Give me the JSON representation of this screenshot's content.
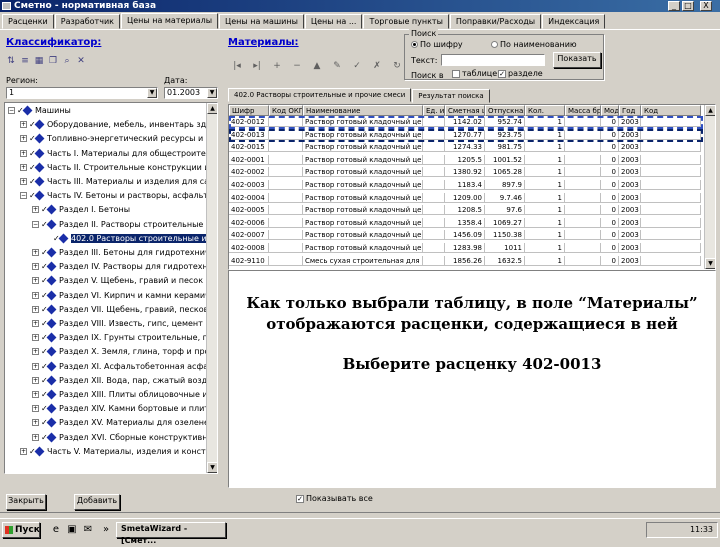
{
  "window": {
    "title": "Сметно - нормативная база",
    "controls": [
      "_",
      "□",
      "X"
    ]
  },
  "tabs": [
    {
      "label": "Расценки",
      "active": false
    },
    {
      "label": "Разработчик",
      "active": false
    },
    {
      "label": "Цены на материалы",
      "active": true
    },
    {
      "label": "Цены на машины",
      "active": false
    },
    {
      "label": "Цены на ...",
      "active": false
    },
    {
      "label": "Торговые пункты",
      "active": false
    },
    {
      "label": "Поправки/Расходы",
      "active": false
    },
    {
      "label": "Индексация",
      "active": false
    }
  ],
  "left": {
    "heading": "Классификатор:",
    "toolbar_icons": [
      "sort-icon",
      "filter-icon",
      "table-icon",
      "copy-icon",
      "find-icon",
      "close-icon"
    ],
    "region_label": "Регион:",
    "date_label": "Дата:",
    "region_value": "1",
    "date_value": "01.2003",
    "tree": [
      {
        "indent": 0,
        "box": "−",
        "label": "Машины",
        "selected": false
      },
      {
        "indent": 1,
        "box": "+",
        "label": "Оборудование, мебель, инвентарь здания и сооружения",
        "selected": false
      },
      {
        "indent": 1,
        "box": "+",
        "label": "Топливно-энергетический ресурсы и строительство",
        "selected": false
      },
      {
        "indent": 1,
        "box": "+",
        "label": "Часть I. Материалы для общестроительных работ",
        "selected": false
      },
      {
        "indent": 1,
        "box": "+",
        "label": "Часть II. Строительные конструкции и изделия",
        "selected": false
      },
      {
        "indent": 1,
        "box": "+",
        "label": "Часть III. Материалы и изделия для сантехнических",
        "selected": false
      },
      {
        "indent": 1,
        "box": "−",
        "label": "Часть IV. Бетоны и растворы, асфальтобетонные и прочие",
        "selected": false
      },
      {
        "indent": 2,
        "box": "+",
        "label": "Раздел I. Бетоны",
        "selected": false
      },
      {
        "indent": 2,
        "box": "−",
        "label": "Раздел II. Растворы строительные и прочие",
        "selected": false
      },
      {
        "indent": 3,
        "box": "",
        "label": "402.0 Растворы строительные и прочие",
        "selected": true
      },
      {
        "indent": 2,
        "box": "+",
        "label": "Раздел III. Бетоны для гидротехнических",
        "selected": false
      },
      {
        "indent": 2,
        "box": "+",
        "label": "Раздел IV. Растворы для гидротехнических",
        "selected": false
      },
      {
        "indent": 2,
        "box": "+",
        "label": "Раздел V. Щебень, гравий и песок для строительных",
        "selected": false
      },
      {
        "indent": 2,
        "box": "+",
        "label": "Раздел VI. Кирпич и камни керамические",
        "selected": false
      },
      {
        "indent": 2,
        "box": "+",
        "label": "Раздел VII. Щебень, гравий, песковые массы",
        "selected": false
      },
      {
        "indent": 2,
        "box": "+",
        "label": "Раздел VIII. Известь, гипс, цемент",
        "selected": false
      },
      {
        "indent": 2,
        "box": "+",
        "label": "Раздел IX. Грунты строительные, песок, грунт",
        "selected": false
      },
      {
        "indent": 2,
        "box": "+",
        "label": "Раздел X. Земля, глина, торф и прочие грунты",
        "selected": false
      },
      {
        "indent": 2,
        "box": "+",
        "label": "Раздел XI. Асфальтобетонная асфальтобетонная",
        "selected": false
      },
      {
        "indent": 2,
        "box": "+",
        "label": "Раздел XII. Вода, пар, сжатый воздух, кислород",
        "selected": false
      },
      {
        "indent": 2,
        "box": "+",
        "label": "Раздел XIII. Плиты облицовочные и материалы",
        "selected": false
      },
      {
        "indent": 2,
        "box": "+",
        "label": "Раздел XIV. Камни бортовые и плиточные",
        "selected": false
      },
      {
        "indent": 2,
        "box": "+",
        "label": "Раздел XV. Материалы для озеленения",
        "selected": false
      },
      {
        "indent": 2,
        "box": "+",
        "label": "Раздел XVI. Сборные конструктивные элементы",
        "selected": false
      },
      {
        "indent": 1,
        "box": "+",
        "label": "Часть V. Материалы, изделия и конструкции для",
        "selected": false
      }
    ],
    "buttons": {
      "close": "Закрыть",
      "add": "Добавить"
    }
  },
  "right": {
    "heading": "Материалы:",
    "search_group_title": "Поиск",
    "radio_by_code": "По шифру",
    "radio_by_name": "По наименованию",
    "text_label": "Текст:",
    "search_button": "Показать",
    "search_text": "",
    "search_in_label": "Поиск в",
    "check_table": "таблице",
    "check_section": "разделе",
    "nav_icons": [
      "first-icon",
      "next-icon",
      "add-icon",
      "remove-icon",
      "up-icon",
      "edit-icon",
      "apply-icon",
      "cancel-icon",
      "refresh-icon"
    ],
    "subtabs": [
      {
        "label": "402.0 Растворы строительные и прочие смеси",
        "active": true
      },
      {
        "label": "Результат поиска",
        "active": false
      }
    ],
    "columns": [
      "Шифр",
      "Код ОКП",
      "Наименование",
      "Ед. изм.",
      "Сметная цена",
      "Отпускная цена",
      "Кол.",
      "Масса брутто",
      "Мод.",
      "Год",
      "Код"
    ],
    "rows": [
      [
        "402-0012",
        "",
        "Раствор готовый кладочный цемент-0",
        "",
        "1142.02",
        "952.74",
        "1",
        "",
        "0",
        "2003",
        ""
      ],
      [
        "402-0013",
        "",
        "Раствор готовый кладочный цемент-0",
        "",
        "1270.77",
        "923.75",
        "1",
        "",
        "0",
        "2003",
        ""
      ],
      [
        "402-0015",
        "",
        "Раствор готовый кладочный цемент-8",
        "",
        "1274.33",
        "981.75",
        "1",
        "",
        "0",
        "2003",
        ""
      ],
      [
        "402-0001",
        "",
        "Раствор готовый кладочный цемент-0",
        "",
        "1205.5",
        "1001.52",
        "1",
        "",
        "0",
        "2003",
        ""
      ],
      [
        "402-0002",
        "",
        "Раствор готовый кладочный цемент-8",
        "",
        "1380.92",
        "1065.28",
        "1",
        "",
        "0",
        "2003",
        ""
      ],
      [
        "402-0003",
        "",
        "Раствор готовый кладочный цемент-0",
        "",
        "1183.4",
        "897.9",
        "1",
        "",
        "0",
        "2003",
        ""
      ],
      [
        "402-0004",
        "",
        "Раствор готовый кладочный цемент-0",
        "",
        "1209.00",
        "9.7.46",
        "1",
        "",
        "0",
        "2003",
        ""
      ],
      [
        "402-0005",
        "",
        "Раствор готовый кладочный цемент-0",
        "",
        "1208.5",
        "97.6",
        "1",
        "",
        "0",
        "2003",
        ""
      ],
      [
        "402-0006",
        "",
        "Раствор готовый кладочный цемент-8",
        "",
        "1358.4",
        "1069.27",
        "1",
        "",
        "0",
        "2003",
        ""
      ],
      [
        "402-0007",
        "",
        "Раствор готовый кладочный цемент-8",
        "",
        "1456.09",
        "1150.38",
        "1",
        "",
        "0",
        "2003",
        ""
      ],
      [
        "402-0008",
        "",
        "Раствор готовый кладочный цемент-8",
        "",
        "1283.98",
        "1011",
        "1",
        "",
        "0",
        "2003",
        ""
      ],
      [
        "402-9110",
        "",
        "Смесь сухая строительная для строительства",
        "",
        "1856.26",
        "1632.5",
        "1",
        "",
        "0",
        "2003",
        ""
      ]
    ],
    "checkbox_all": "Показывать все"
  },
  "overlay": {
    "line1": "Как только выбрали таблицу, в поле “Материалы”",
    "line2": "отображаются расценки, содержащиеся в ней",
    "line3": "Выберите расценку 402-0013"
  },
  "taskbar": {
    "start": "Пуск",
    "task": "SmetaWizard - [Смет...",
    "clock": "11:33"
  }
}
